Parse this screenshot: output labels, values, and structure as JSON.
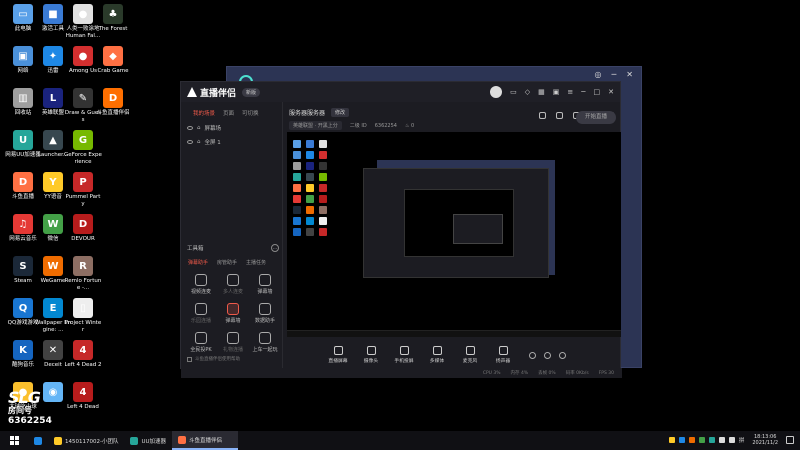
{
  "desktop": {
    "icons": [
      {
        "label": "此电脑",
        "color": "#5aa0e8",
        "glyph": "▭"
      },
      {
        "label": "激活工具",
        "color": "#3a7bd5",
        "glyph": "■"
      },
      {
        "label": "人类一败涂地 Human Fal...",
        "color": "#e0e0e0",
        "glyph": "●"
      },
      {
        "label": "The Forest",
        "color": "#2a3a2a",
        "glyph": "♣"
      },
      {
        "label": "网络",
        "color": "#4a90d9",
        "glyph": "▣"
      },
      {
        "label": "迅雷",
        "color": "#1e88e5",
        "glyph": "✦"
      },
      {
        "label": "Among Us",
        "color": "#d32f2f",
        "glyph": "●"
      },
      {
        "label": "Crab Game",
        "color": "#ff7043",
        "glyph": "◆"
      },
      {
        "label": "回收站",
        "color": "#9e9e9e",
        "glyph": "▥"
      },
      {
        "label": "英雄联盟",
        "color": "#1a237e",
        "glyph": "L"
      },
      {
        "label": "Draw & Guess",
        "color": "#333333",
        "glyph": "✎"
      },
      {
        "label": "斗鱼直播伴侣",
        "color": "#ff6f00",
        "glyph": "D"
      },
      {
        "label": "网易UU加速器",
        "color": "#26a69a",
        "glyph": "U"
      },
      {
        "label": "Launcher...",
        "color": "#37474f",
        "glyph": "▲"
      },
      {
        "label": "GeForce Experience",
        "color": "#76b900",
        "glyph": "G"
      },
      {
        "label": "斗鱼直播",
        "color": "#ff7043",
        "glyph": "D"
      },
      {
        "label": "YY语音",
        "color": "#ffca28",
        "glyph": "Y"
      },
      {
        "label": "Pummel Party",
        "color": "#c62828",
        "glyph": "P"
      },
      {
        "label": "网易云音乐",
        "color": "#e53935",
        "glyph": "♫"
      },
      {
        "label": "微信",
        "color": "#43a047",
        "glyph": "W"
      },
      {
        "label": "DEVOUR",
        "color": "#b71c1c",
        "glyph": "D"
      },
      {
        "label": "Steam",
        "color": "#1b2838",
        "glyph": "S"
      },
      {
        "label": "WeGame",
        "color": "#ef6c00",
        "glyph": "W"
      },
      {
        "label": "Remlo Fortune -...",
        "color": "#8d6e63",
        "glyph": "R"
      },
      {
        "label": "QQ游戏游戏",
        "color": "#1976d2",
        "glyph": "Q"
      },
      {
        "label": "Wallpaper Engine: ...",
        "color": "#0288d1",
        "glyph": "E"
      },
      {
        "label": "Project Winter",
        "color": "#eeeeee",
        "glyph": "▯"
      },
      {
        "label": "酷狗音乐",
        "color": "#1565c0",
        "glyph": "K"
      },
      {
        "label": "Deceit",
        "color": "#424242",
        "glyph": "✕"
      },
      {
        "label": "Left 4 Dead 2",
        "color": "#c62828",
        "glyph": "4"
      },
      {
        "label": "大球吃小球",
        "color": "#fbc02d",
        "glyph": "●"
      },
      {
        "label": "",
        "color": "#64b5f6",
        "glyph": "◉"
      },
      {
        "label": "Left 4 Dead",
        "color": "#b71c1c",
        "glyph": "4"
      }
    ]
  },
  "main_window": {
    "app_name": "直播伴侣",
    "version_pill": "新版",
    "left_tabs": [
      "我的场景",
      "页面",
      "可切换"
    ],
    "scenes": [
      "屏幕场",
      "全屏 1"
    ],
    "tools_title": "工具箱",
    "tool_tabs": [
      "弹幕助手",
      "房管助手",
      "主播任务"
    ],
    "tools": [
      {
        "label": "视频连麦",
        "red": false,
        "dim": false
      },
      {
        "label": "多人连麦",
        "red": false,
        "dim": true
      },
      {
        "label": "弹幕墙",
        "red": false,
        "dim": false
      },
      {
        "label": "乐园连播",
        "red": false,
        "dim": true
      },
      {
        "label": "弹幕墙",
        "red": true,
        "dim": false
      },
      {
        "label": "数据助手",
        "red": false,
        "dim": false
      },
      {
        "label": "全民投PK",
        "red": false,
        "dim": false
      },
      {
        "label": "礼物连播",
        "red": false,
        "dim": true
      },
      {
        "label": "上车一起玩",
        "red": false,
        "dim": false
      }
    ],
    "left_footer": "斗鱼直播伴侣使用帮助",
    "room_title": "服务器服务器",
    "room_tag": "修改",
    "room_sub": [
      "英雄联盟 · 开黑上分",
      "二级 ID",
      "6362254"
    ],
    "bottom_tools": [
      "直播屏幕",
      "摄像头",
      "手机投屏",
      "多媒体",
      "麦克风",
      "扬声器"
    ],
    "start_live": "开始直播",
    "status": [
      "CPU 3%",
      "内存 4%",
      "丢帧 0%",
      "码率 0Kb/s",
      "FPS 30"
    ]
  },
  "overlay": {
    "brand": "SLG",
    "label": "房间号",
    "room_number": "6362254"
  },
  "taskbar": {
    "tasks": [
      {
        "label": "1450117002-小团队",
        "color": "#ffca28",
        "active": false
      },
      {
        "label": "UU加速器",
        "color": "#26a69a",
        "active": false
      },
      {
        "label": "斗鱼直播伴侣",
        "color": "#ff7043",
        "active": true
      }
    ],
    "tray_lang": "拼",
    "time": "18:13:06",
    "date": "2021/11/2"
  }
}
